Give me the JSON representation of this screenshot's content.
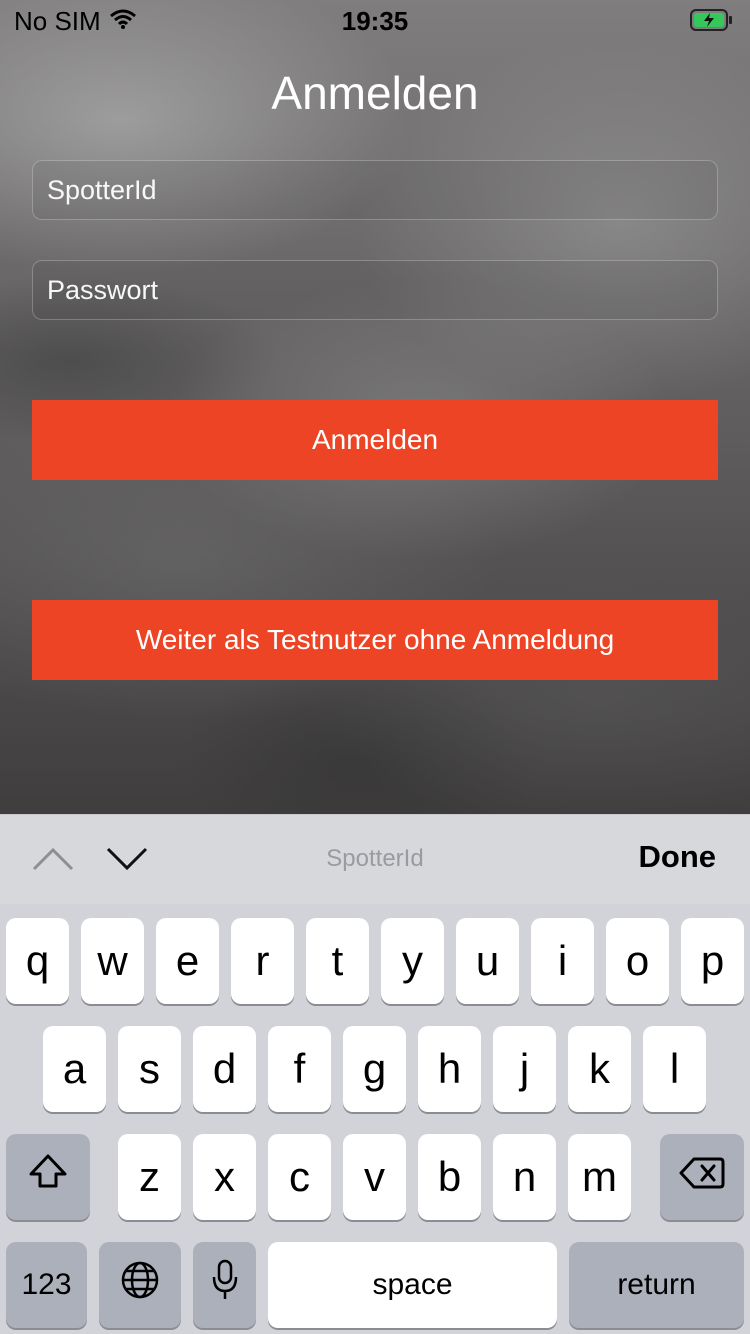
{
  "status_bar": {
    "carrier": "No SIM",
    "time": "19:35",
    "wifi_icon": "wifi-icon",
    "battery_icon": "battery-charging-icon"
  },
  "login": {
    "title": "Anmelden",
    "spotter_placeholder": "SpotterId",
    "password_placeholder": "Passwort",
    "login_button": "Anmelden",
    "guest_button": "Weiter als Testnutzer ohne Anmeldung"
  },
  "accessory_bar": {
    "field_label": "SpotterId",
    "done_label": "Done",
    "up_icon": "chevron-up-icon",
    "down_icon": "chevron-down-icon"
  },
  "keyboard": {
    "row1": [
      "q",
      "w",
      "e",
      "r",
      "t",
      "y",
      "u",
      "i",
      "o",
      "p"
    ],
    "row2": [
      "a",
      "s",
      "d",
      "f",
      "g",
      "h",
      "j",
      "k",
      "l"
    ],
    "row3": [
      "z",
      "x",
      "c",
      "v",
      "b",
      "n",
      "m"
    ],
    "numbers_label": "123",
    "space_label": "space",
    "return_label": "return",
    "shift_icon": "shift-icon",
    "delete_icon": "delete-icon",
    "globe_icon": "globe-icon",
    "mic_icon": "microphone-icon"
  },
  "colors": {
    "accent": "#ec4424",
    "keyboard_bg": "#d1d3d9"
  }
}
